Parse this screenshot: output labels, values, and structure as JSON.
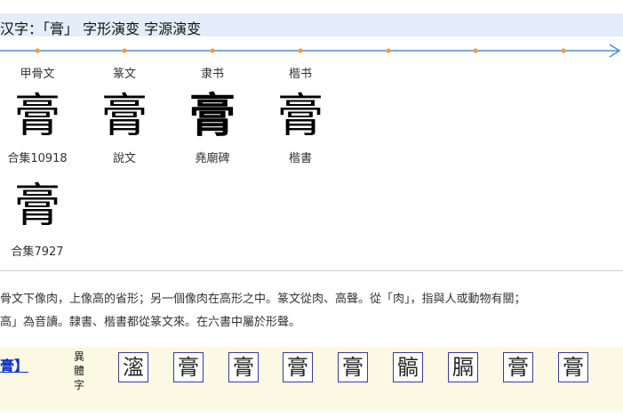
{
  "header": {
    "title": "汉字：「膏」 字形演变 字源演变"
  },
  "evolution": [
    {
      "script_label": "甲骨文",
      "glyph": "膏",
      "source": "合集10918"
    },
    {
      "script_label": "篆文",
      "glyph": "膏",
      "source": "說文"
    },
    {
      "script_label": "隶书",
      "glyph": "膏",
      "source": "堯廟碑"
    },
    {
      "script_label": "楷书",
      "glyph": "膏",
      "source": "楷書"
    }
  ],
  "extra_oracle": {
    "glyph": "膏",
    "source": "合集7927"
  },
  "description": {
    "line1": "骨文下像肉，上像高的省形；另一個像肉在高形之中。篆文從肉、高聲。從「肉」，指與人或動物有關；",
    "line2": "高」為音讀。隸書、楷書都從篆文來。在六書中屬於形聲。"
  },
  "variants": {
    "link_text": "膏】",
    "label": "異體字",
    "label_chars": [
      "異",
      "體",
      "字"
    ],
    "chars": [
      "㵥",
      "膏",
      "膏",
      "膏",
      "膏",
      "髇",
      "膈",
      "膏",
      "膏"
    ]
  },
  "colors": {
    "accent": "#4a90d9",
    "dot": "#f0a030",
    "title_bg": "#e3eefa",
    "variants_bg": "#fbf9e4",
    "link": "#1030d0"
  }
}
